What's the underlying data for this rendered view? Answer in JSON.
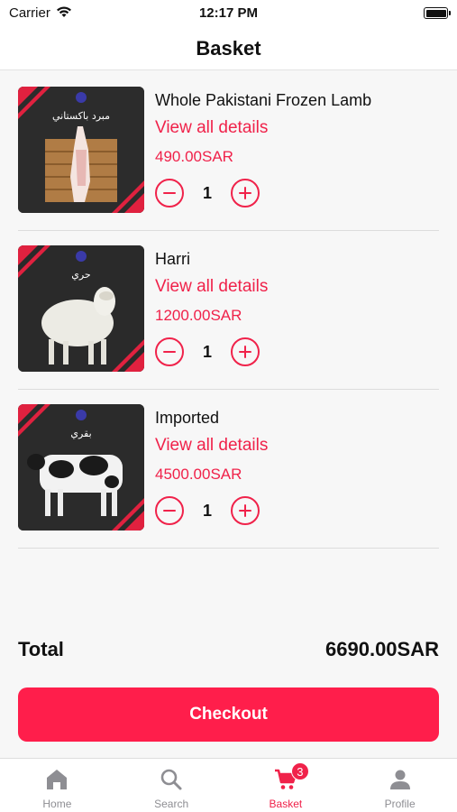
{
  "status_bar": {
    "carrier": "Carrier",
    "time": "12:17 PM"
  },
  "header": {
    "title": "Basket"
  },
  "items": [
    {
      "name": "Whole Pakistani Frozen Lamb",
      "details_label": "View all details",
      "price": "490.00SAR",
      "quantity": "1",
      "image_caption": "مبرد باكستاني"
    },
    {
      "name": "Harri",
      "details_label": "View all details",
      "price": "1200.00SAR",
      "quantity": "1",
      "image_caption": "حري"
    },
    {
      "name": "Imported",
      "details_label": "View all details",
      "price": "4500.00SAR",
      "quantity": "1",
      "image_caption": "بقري"
    }
  ],
  "summary": {
    "total_label": "Total",
    "total_value": "6690.00SAR"
  },
  "checkout": {
    "label": "Checkout"
  },
  "tabbar": {
    "tabs": [
      {
        "label": "Home",
        "icon": "home-icon"
      },
      {
        "label": "Search",
        "icon": "search-icon"
      },
      {
        "label": "Basket",
        "icon": "cart-icon",
        "badge": "3"
      },
      {
        "label": "Profile",
        "icon": "profile-icon"
      }
    ],
    "active": "Basket"
  },
  "colors": {
    "accent": "#f0224a",
    "button": "#ff1e4b",
    "inactive": "#8e8e93"
  }
}
